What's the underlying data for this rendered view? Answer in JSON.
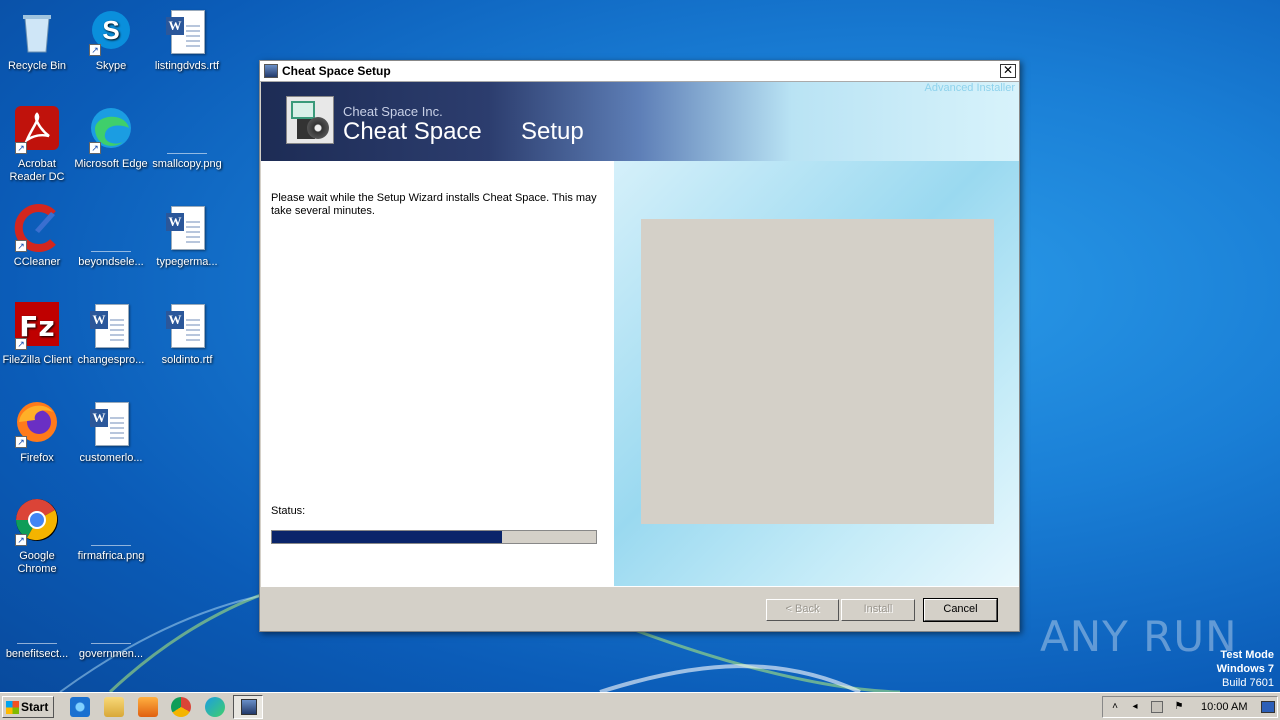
{
  "desktop": {
    "icons": [
      {
        "label": "Recycle Bin",
        "icon": "recycle-bin-icon"
      },
      {
        "label": "Skype",
        "icon": "skype-icon"
      },
      {
        "label": "listingdvds.rtf",
        "icon": "word-document-icon"
      },
      {
        "label": "Acrobat Reader DC",
        "icon": "acrobat-icon"
      },
      {
        "label": "Microsoft Edge",
        "icon": "edge-icon"
      },
      {
        "label": "smallcopy.png",
        "icon": "image-file-icon"
      },
      {
        "label": "CCleaner",
        "icon": "ccleaner-icon"
      },
      {
        "label": "beyondsele...",
        "icon": "image-file-icon"
      },
      {
        "label": "typegerma...",
        "icon": "word-document-icon"
      },
      {
        "label": "FileZilla Client",
        "icon": "filezilla-icon"
      },
      {
        "label": "changespro...",
        "icon": "word-document-icon"
      },
      {
        "label": "soldinto.rtf",
        "icon": "word-document-icon"
      },
      {
        "label": "Firefox",
        "icon": "firefox-icon"
      },
      {
        "label": "customerlo...",
        "icon": "word-document-icon"
      },
      {
        "label": "Google Chrome",
        "icon": "chrome-icon"
      },
      {
        "label": "firmafrica.png",
        "icon": "image-file-icon"
      },
      {
        "label": "benefitsect...",
        "icon": "image-file-icon"
      },
      {
        "label": "governmen...",
        "icon": "image-file-icon"
      }
    ]
  },
  "window": {
    "title": "Cheat Space Setup",
    "close_glyph": "✕",
    "banner": {
      "company": "Cheat Space Inc.",
      "product": "Cheat Space",
      "setup": "Setup",
      "brand": "Advanced Installer"
    },
    "message": "Please wait while the Setup Wizard installs Cheat Space.  This may take several minutes.",
    "status_label": "Status:",
    "progress": 0.71,
    "buttons": {
      "back": "< Back",
      "install": "Install",
      "cancel": "Cancel"
    }
  },
  "watermark": {
    "text": "ANY RUN",
    "test_mode": "Test Mode",
    "os": "Windows 7",
    "build": "Build 7601"
  },
  "taskbar": {
    "start_label": "Start",
    "clock": "10:00 AM",
    "colors": {
      "progress_fill": "#0a246a",
      "desktop": "#1a7fd6"
    }
  }
}
